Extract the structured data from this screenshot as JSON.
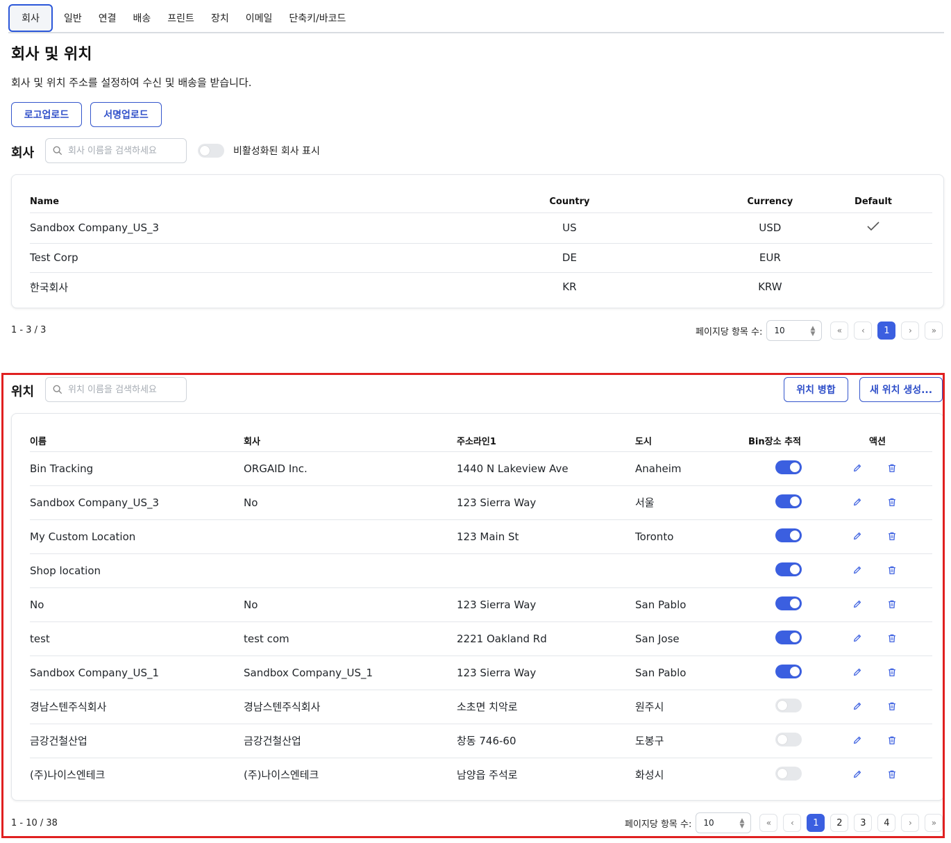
{
  "tabs": [
    "회사",
    "일반",
    "연결",
    "배송",
    "프린트",
    "장치",
    "이메일",
    "단축키/바코드"
  ],
  "page": {
    "title": "회사 및 위치",
    "description": "회사 및 위치 주소를 설정하여 수신 및 배송을 받습니다.",
    "logo_upload": "로고업로드",
    "signature_upload": "서명업로드"
  },
  "company": {
    "section_label": "회사",
    "search_placeholder": "회사 이름을 검색하세요",
    "show_inactive_label": "비활성화된 회사 표시",
    "columns": {
      "name": "Name",
      "country": "Country",
      "currency": "Currency",
      "default": "Default"
    },
    "rows": [
      {
        "name": "Sandbox Company_US_3",
        "country": "US",
        "currency": "USD",
        "default": true
      },
      {
        "name": "Test Corp",
        "country": "DE",
        "currency": "EUR",
        "default": false
      },
      {
        "name": "한국회사",
        "country": "KR",
        "currency": "KRW",
        "default": false
      }
    ],
    "pager": {
      "info": "1 - 3 / 3",
      "per_page_label": "페이지당 항목 수:",
      "per_page": "10",
      "pages": [
        "1"
      ],
      "current": "1"
    }
  },
  "location": {
    "section_label": "위치",
    "search_placeholder": "위치 이름을 검색하세요",
    "merge_button": "위치 병합",
    "create_button": "새 위치 생성...",
    "columns": {
      "name": "이름",
      "company": "회사",
      "address": "주소라인1",
      "city": "도시",
      "bin": "Bin장소 추적",
      "actions": "액션"
    },
    "rows": [
      {
        "name": "Bin Tracking",
        "company": "ORGAID Inc.",
        "address": "1440 N Lakeview Ave",
        "city": "Anaheim",
        "bin": true
      },
      {
        "name": "Sandbox Company_US_3",
        "company": "No",
        "address": "123 Sierra Way",
        "city": "서울",
        "bin": true
      },
      {
        "name": "My Custom Location",
        "company": "",
        "address": "123 Main St",
        "city": "Toronto",
        "bin": true
      },
      {
        "name": "Shop location",
        "company": "",
        "address": "",
        "city": "",
        "bin": true
      },
      {
        "name": "No",
        "company": "No",
        "address": "123 Sierra Way",
        "city": "San Pablo",
        "bin": true
      },
      {
        "name": "test",
        "company": "test com",
        "address": "2221 Oakland Rd",
        "city": "San Jose",
        "bin": true
      },
      {
        "name": "Sandbox Company_US_1",
        "company": "Sandbox Company_US_1",
        "address": "123 Sierra Way",
        "city": "San Pablo",
        "bin": true
      },
      {
        "name": "경남스텐주식회사",
        "company": "경남스텐주식회사",
        "address": "소초면 치악로",
        "city": "원주시",
        "bin": false
      },
      {
        "name": "금강건철산업",
        "company": "금강건철산업",
        "address": "창동 746-60",
        "city": "도봉구",
        "bin": false
      },
      {
        "name": "(주)나이스엔테크",
        "company": "(주)나이스엔테크",
        "address": "남양읍 주석로",
        "city": "화성시",
        "bin": false
      }
    ],
    "pager": {
      "info": "1 - 10 / 38",
      "per_page_label": "페이지당 항목 수:",
      "per_page": "10",
      "pages": [
        "1",
        "2",
        "3",
        "4"
      ],
      "current": "1"
    }
  },
  "colors": {
    "accent": "#3b5fe0",
    "highlight_border": "#e02020"
  }
}
